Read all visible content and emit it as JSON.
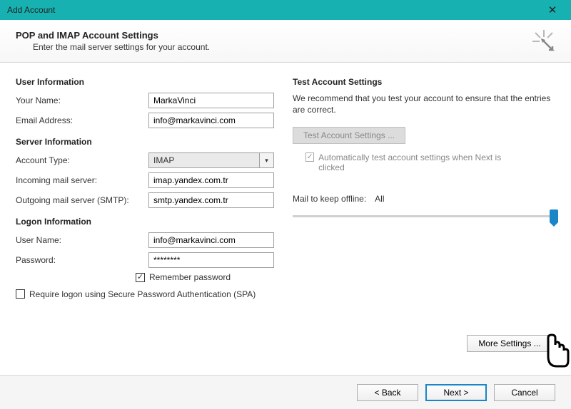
{
  "window": {
    "title": "Add Account"
  },
  "header": {
    "title": "POP and IMAP Account Settings",
    "subtitle": "Enter the mail server settings for your account."
  },
  "left": {
    "user_info_head": "User Information",
    "your_name_label": "Your Name:",
    "your_name_value": "MarkaVinci",
    "email_label": "Email Address:",
    "email_value": "info@markavinci.com",
    "server_info_head": "Server Information",
    "account_type_label": "Account Type:",
    "account_type_value": "IMAP",
    "incoming_label": "Incoming mail server:",
    "incoming_value": "imap.yandex.com.tr",
    "outgoing_label": "Outgoing mail server (SMTP):",
    "outgoing_value": "smtp.yandex.com.tr",
    "logon_head": "Logon Information",
    "user_name_label": "User Name:",
    "user_name_value": "info@markavinci.com",
    "password_label": "Password:",
    "password_value": "********",
    "remember_label": "Remember password",
    "spa_label": "Require logon using Secure Password Authentication (SPA)"
  },
  "right": {
    "head": "Test Account Settings",
    "para": "We recommend that you test your account to ensure that the entries are correct.",
    "test_btn": "Test Account Settings ...",
    "auto_test": "Automatically test account settings when Next is clicked",
    "mail_offline_label": "Mail to keep offline:",
    "mail_offline_value": "All",
    "more_settings": "More Settings ..."
  },
  "footer": {
    "back": "< Back",
    "next": "Next >",
    "cancel": "Cancel"
  }
}
